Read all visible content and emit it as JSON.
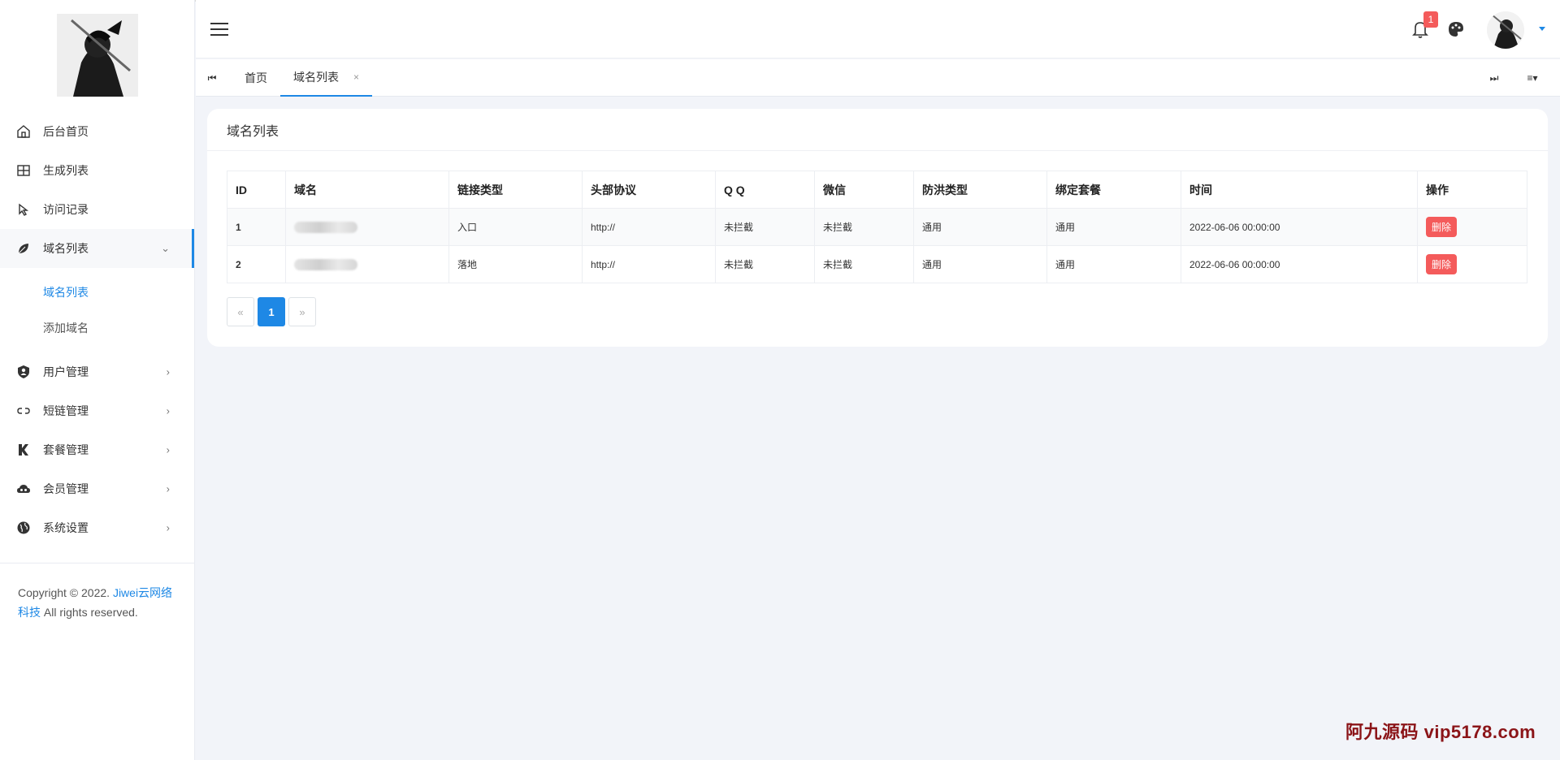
{
  "sidebar": {
    "items": [
      {
        "label": "后台首页"
      },
      {
        "label": "生成列表"
      },
      {
        "label": "访问记录"
      },
      {
        "label": "域名列表",
        "open": true,
        "children": [
          {
            "label": "域名列表",
            "active": true
          },
          {
            "label": "添加域名"
          }
        ]
      },
      {
        "label": "用户管理"
      },
      {
        "label": "短链管理"
      },
      {
        "label": "套餐管理"
      },
      {
        "label": "会员管理"
      },
      {
        "label": "系统设置"
      }
    ],
    "footer": {
      "prefix": "Copyright © 2022.",
      "link": "Jiwei云网络科技",
      "suffix": "All rights reserved."
    }
  },
  "header": {
    "notification_count": "1"
  },
  "tabs": {
    "home": "首页",
    "active": "域名列表",
    "close": "×"
  },
  "card": {
    "title": "域名列表"
  },
  "table": {
    "headers": [
      "ID",
      "域名",
      "链接类型",
      "头部协议",
      "Q Q",
      "微信",
      "防洪类型",
      "绑定套餐",
      "时间",
      "操作"
    ],
    "rows": [
      {
        "id": "1",
        "type": "入口",
        "protocol": "http://",
        "qq": "未拦截",
        "wechat": "未拦截",
        "flood": "通用",
        "package": "通用",
        "time": "2022-06-06 00:00:00",
        "action": "删除"
      },
      {
        "id": "2",
        "type": "落地",
        "protocol": "http://",
        "qq": "未拦截",
        "wechat": "未拦截",
        "flood": "通用",
        "package": "通用",
        "time": "2022-06-06 00:00:00",
        "action": "删除"
      }
    ]
  },
  "pagination": {
    "prev": "«",
    "current": "1",
    "next": "»"
  },
  "watermark": "阿九源码  vip5178.com",
  "colors": {
    "accent": "#1e88e5",
    "danger": "#f45b5b",
    "success": "#27a143"
  }
}
